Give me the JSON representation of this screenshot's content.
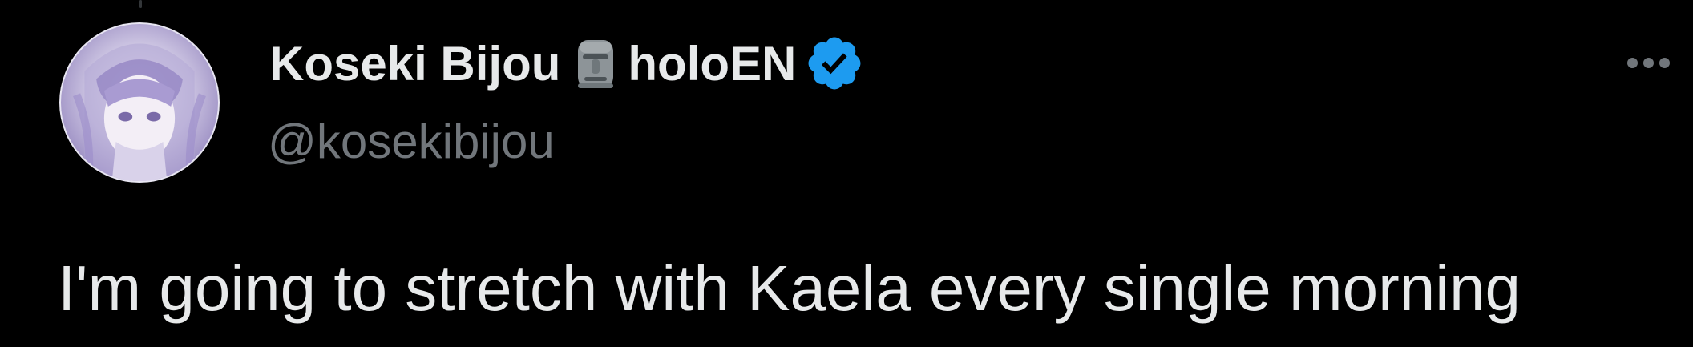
{
  "tweet": {
    "author": {
      "display_name_part1": "Koseki Bijou",
      "display_name_part2": "holoEN",
      "name_emoji_icon": "moai-icon",
      "verified_icon": "verified-badge-icon",
      "handle": "@kosekibijou",
      "avatar_icon": "avatar-image"
    },
    "more_icon": "more-horizontal-icon",
    "text": "I'm going to stretch with Kaela every single morning"
  },
  "colors": {
    "background": "#000000",
    "primary_text": "#e7e9ea",
    "secondary_text": "#71767b",
    "verified_blue": "#1d9bf0"
  }
}
